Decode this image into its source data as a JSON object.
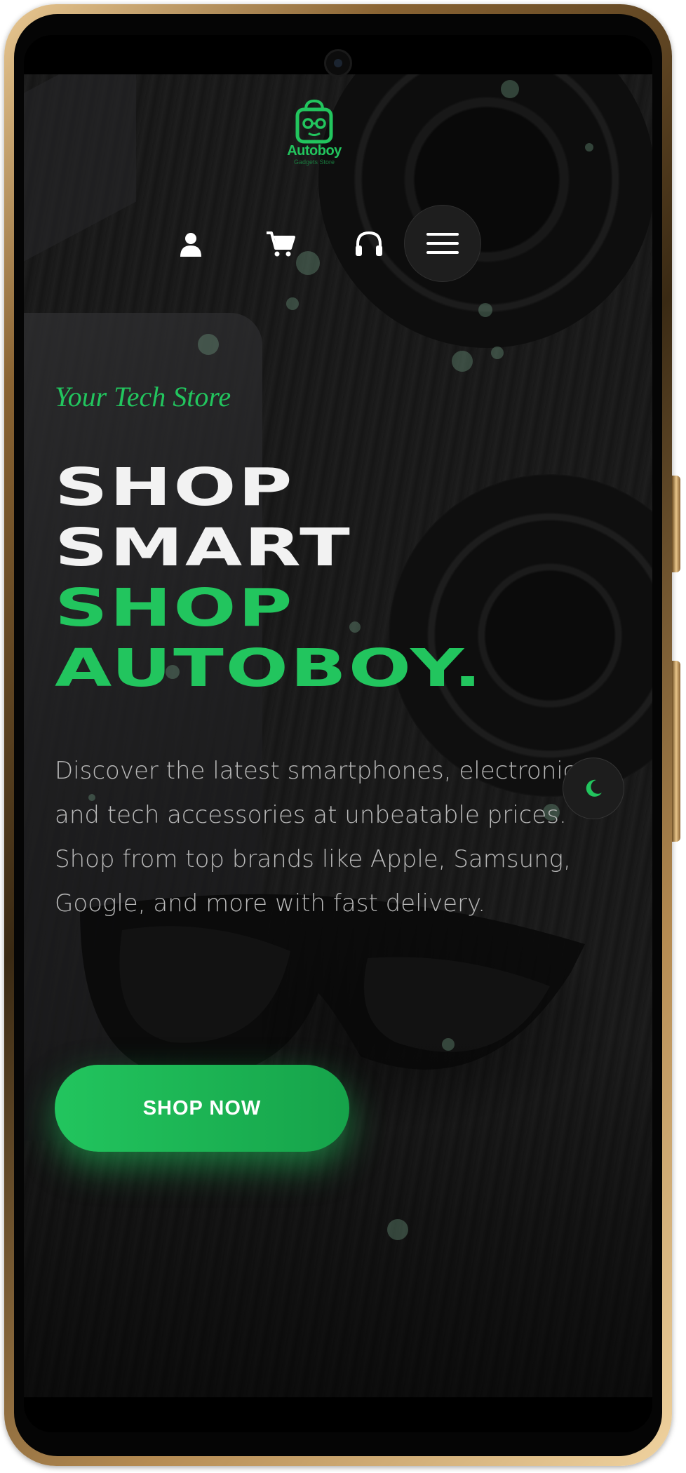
{
  "header": {
    "logo": {
      "brand": "Autoboy",
      "tagline": "Gadgets Store"
    },
    "icons": [
      "user-icon",
      "cart-icon",
      "headset-icon",
      "menu-icon"
    ]
  },
  "hero": {
    "tagline": "Your Tech Store",
    "headline": {
      "line1": "SHOP",
      "line2": "SMART",
      "line3": "SHOP",
      "line4": "AUTOBOY."
    },
    "description": "Discover the latest smartphones, electronics, and tech accessories at unbeatable prices. Shop from top brands like Apple, Samsung, Google, and more with fast delivery.",
    "cta_label": "SHOP NOW"
  },
  "theme_toggle": {
    "icon": "moon-icon"
  },
  "colors": {
    "accent": "#22c55e",
    "background": "#151515",
    "text_primary": "#f2f2f2",
    "text_secondary": "#b9b9b9"
  }
}
